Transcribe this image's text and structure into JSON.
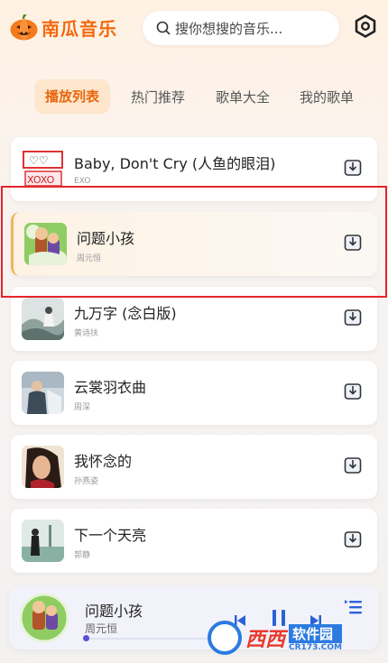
{
  "app": {
    "name": "南瓜音乐"
  },
  "search": {
    "placeholder": "搜你想搜的音乐..."
  },
  "tabs": [
    {
      "label": "播放列表",
      "active": true
    },
    {
      "label": "热门推荐",
      "active": false
    },
    {
      "label": "歌单大全",
      "active": false
    },
    {
      "label": "我的歌单",
      "active": false
    }
  ],
  "songs": [
    {
      "title": "Baby, Don't Cry (人鱼的眼泪)",
      "artist": "EXO",
      "active": false
    },
    {
      "title": "问题小孩",
      "artist": "周元恒",
      "active": true
    },
    {
      "title": "九万字 (念白版)",
      "artist": "黄诗扶",
      "active": false
    },
    {
      "title": "云裳羽衣曲",
      "artist": "周深",
      "active": false
    },
    {
      "title": "我怀念的",
      "artist": "孙燕姿",
      "active": false
    },
    {
      "title": "下一个天亮",
      "artist": "郭静",
      "active": false
    }
  ],
  "player": {
    "title": "问题小孩",
    "artist": "周元恒",
    "progress": 0.02
  },
  "watermark": {
    "brand": "西西",
    "label": "软件园",
    "url": "CR173.COM"
  },
  "colors": {
    "accent": "#f26a10",
    "highlight": "#e5252b",
    "progress": "#5b4fd6"
  },
  "icons": [
    "pumpkin-logo-icon",
    "search-icon",
    "settings-hexagon-icon",
    "download-icon",
    "previous-icon",
    "pause-icon",
    "next-icon",
    "playlist-icon"
  ]
}
